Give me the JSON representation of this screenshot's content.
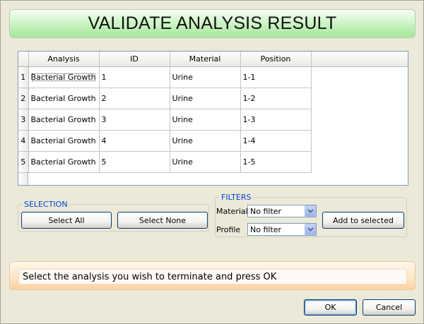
{
  "title": "VALIDATE ANALYSIS RESULT",
  "table": {
    "columns": [
      "Analysis",
      "ID",
      "Material",
      "Position"
    ],
    "rows": [
      {
        "num": "1",
        "analysis": "Bacterial Growth",
        "id": "1",
        "material": "Urine",
        "position": "1-1"
      },
      {
        "num": "2",
        "analysis": "Bacterial Growth",
        "id": "2",
        "material": "Urine",
        "position": "1-2"
      },
      {
        "num": "3",
        "analysis": "Bacterial Growth",
        "id": "3",
        "material": "Urine",
        "position": "1-3"
      },
      {
        "num": "4",
        "analysis": "Bacterial Growth",
        "id": "4",
        "material": "Urine",
        "position": "1-4"
      },
      {
        "num": "5",
        "analysis": "Bacterial Growth",
        "id": "5",
        "material": "Urine",
        "position": "1-5"
      }
    ]
  },
  "selection": {
    "legend": "SELECTION",
    "select_all": "Select All",
    "select_none": "Select None"
  },
  "filters": {
    "legend": "FILTERS",
    "material_label": "Material",
    "material_value": "No filter",
    "profile_label": "Profile",
    "profile_value": "No filter",
    "add_button": "Add to selected"
  },
  "status": {
    "message": "Select the analysis you wish to terminate and press OK"
  },
  "footer": {
    "ok": "OK",
    "cancel": "Cancel"
  },
  "colors": {
    "title_banner": "#a4e79a",
    "status_banner": "#fdd2a0",
    "legend_text": "#0046d5",
    "button_border": "#003c74"
  },
  "icons": {
    "combo_arrow": "chevron-down-icon"
  }
}
